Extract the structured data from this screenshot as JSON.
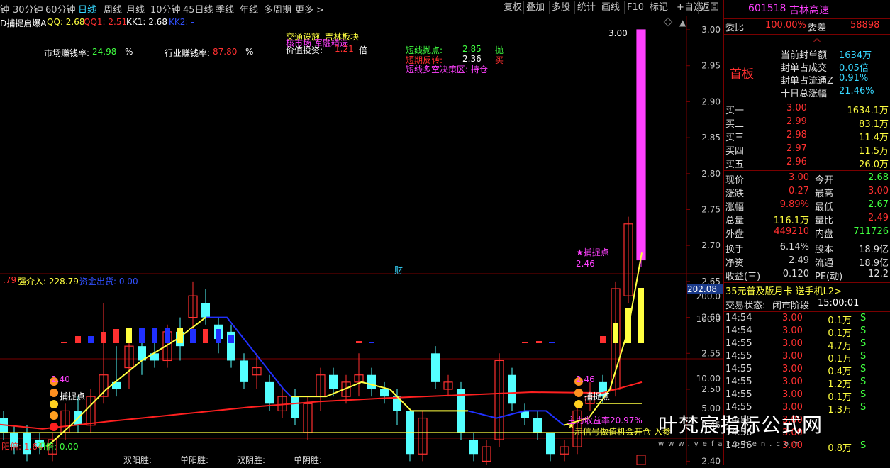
{
  "topbar": {
    "timeframes": [
      "钟",
      "30分钟",
      "60分钟",
      "日线",
      "周线",
      "月线",
      "10分钟",
      "45日线",
      "季线",
      "年线",
      "多周期",
      "更多 >"
    ],
    "active": "日线",
    "buttons": [
      "复权",
      "叠加",
      "多股",
      "统计",
      "画线",
      "F10",
      "标记",
      "+自选",
      "返回"
    ]
  },
  "chart": {
    "title": "D捕捉启爆A",
    "qq": "QQ: 2.68",
    "qq1": "QQ1: 2.51",
    "kk1": "KK1: 2.68",
    "kk2": "KK2: -",
    "market_label": "市场赚钱率:",
    "market_value": "24.98",
    "market_unit": "%",
    "industry_label": "行业赚钱率:",
    "industry_value": "87.80",
    "industry_unit": "%",
    "sector1": "交通设施",
    "sector2": "吉林板块",
    "sector3": "核市场 军融精选",
    "value_label": "价值投资:",
    "value_value": "1.21",
    "value_unit": "倍",
    "short_point_label": "短线抛点:",
    "short_point_value": "2.85",
    "short_point_action": "抛",
    "short_rev_label": "短期反转:",
    "short_rev_value": "2.36",
    "short_rev_action": "买",
    "zone_label": "短线多空决策区:",
    "zone_value": "持仓",
    "peak_label": "3.00",
    "catch_label": "★捕捉点",
    "catch_value": "2.46",
    "cai": "财",
    "y_ticks": [
      "3.00",
      "2.95",
      "2.90",
      "2.85",
      "2.80",
      "2.75",
      "2.70",
      "2.65",
      "2.60",
      "2.55",
      "2.50",
      "2.45",
      "2.40"
    ],
    "highlight_tick": "202.08",
    "sub1_label_a": ".79",
    "sub1_label_b": "强介入: 228.79",
    "sub1_label_c": "资金出货: 0.00",
    "sub1_ticks": [
      "200.0",
      "100.0"
    ],
    "sub2_ticks": [
      "10.00",
      "5.00"
    ],
    "sub2_left_val": "2.40",
    "sub2_right_val": "2.46",
    "sub2_catch": "捕捉点",
    "sub2_income": "主力收益率20.97%",
    "sub2_signal": "示信号做值机会开仓 入参",
    "bottom_yang": "阳倍: 1.64",
    "bottom_yin": "阴倍: 0.00",
    "bottom_labels": [
      "双阳胜:",
      "单阳胜:",
      "双阴胜:",
      "单阴胜:"
    ]
  },
  "quote": {
    "code": "601518",
    "name": "吉林高速",
    "weibi_label": "委比",
    "weibi_value": "100.00%",
    "weicha_label": "委差",
    "weicha_value": "58898",
    "board": "首板",
    "info": [
      {
        "label": "当前封单额",
        "value": "1634万"
      },
      {
        "label": "封单占成交",
        "value": "0.05倍"
      },
      {
        "label": "封单占流通Z",
        "value": "0.91%"
      },
      {
        "label": "十日总涨幅",
        "value": "21.46%"
      }
    ],
    "bids": [
      {
        "label": "买一",
        "price": "3.00",
        "vol": "1634.1万"
      },
      {
        "label": "买二",
        "price": "2.99",
        "vol": "83.1万"
      },
      {
        "label": "买三",
        "price": "2.98",
        "vol": "11.4万"
      },
      {
        "label": "买四",
        "price": "2.97",
        "vol": "11.5万"
      },
      {
        "label": "买五",
        "price": "2.96",
        "vol": "26.0万"
      }
    ],
    "stats": [
      {
        "l1": "现价",
        "v1": "3.00",
        "l2": "今开",
        "v2": "2.68"
      },
      {
        "l1": "涨跌",
        "v1": "0.27",
        "l2": "最高",
        "v2": "3.00"
      },
      {
        "l1": "涨幅",
        "v1": "9.89%",
        "l2": "最低",
        "v2": "2.67"
      },
      {
        "l1": "总量",
        "v1": "116.1万",
        "l2": "量比",
        "v2": "2.49"
      },
      {
        "l1": "外盘",
        "v1": "449210",
        "l2": "内盘",
        "v2": "711726"
      }
    ],
    "stats2": [
      {
        "l1": "换手",
        "v1": "6.14%",
        "l2": "股本",
        "v2": "18.9亿"
      },
      {
        "l1": "净资",
        "v1": "2.49",
        "l2": "流通",
        "v2": "18.9亿"
      },
      {
        "l1": "收益(三)",
        "v1": "0.120",
        "l2": "PE(动)",
        "v2": "12.2"
      }
    ],
    "promo": "35元普及版月卡 送手机L2>",
    "trade_state_label": "交易状态:",
    "trade_state": "闭市阶段",
    "trade_time": "15:00:01",
    "ticks": [
      {
        "t": "14:54",
        "p": "3.00",
        "v": "0.1万",
        "s": "S"
      },
      {
        "t": "14:54",
        "p": "3.00",
        "v": "0.1万",
        "s": "S"
      },
      {
        "t": "14:55",
        "p": "3.00",
        "v": "4.7万",
        "s": "S"
      },
      {
        "t": "14:55",
        "p": "3.00",
        "v": "0.1万",
        "s": "S"
      },
      {
        "t": "14:55",
        "p": "3.00",
        "v": "0.4万",
        "s": "S"
      },
      {
        "t": "14:55",
        "p": "3.00",
        "v": "1.2万",
        "s": "S"
      },
      {
        "t": "14:55",
        "p": "3.00",
        "v": "0.1万",
        "s": "S"
      },
      {
        "t": "14:55",
        "p": "3.00",
        "v": "1.3万",
        "s": "S"
      },
      {
        "t": "14:55",
        "p": "3.00",
        "v": "",
        "s": ""
      },
      {
        "t": "14:56",
        "p": "3.00",
        "v": "",
        "s": ""
      },
      {
        "t": "14:56",
        "p": "3.00",
        "v": "0.8万",
        "s": "S"
      }
    ]
  },
  "watermark": {
    "title": "叶梵宸指标公式网",
    "url": "www.yefanchen.com"
  }
}
